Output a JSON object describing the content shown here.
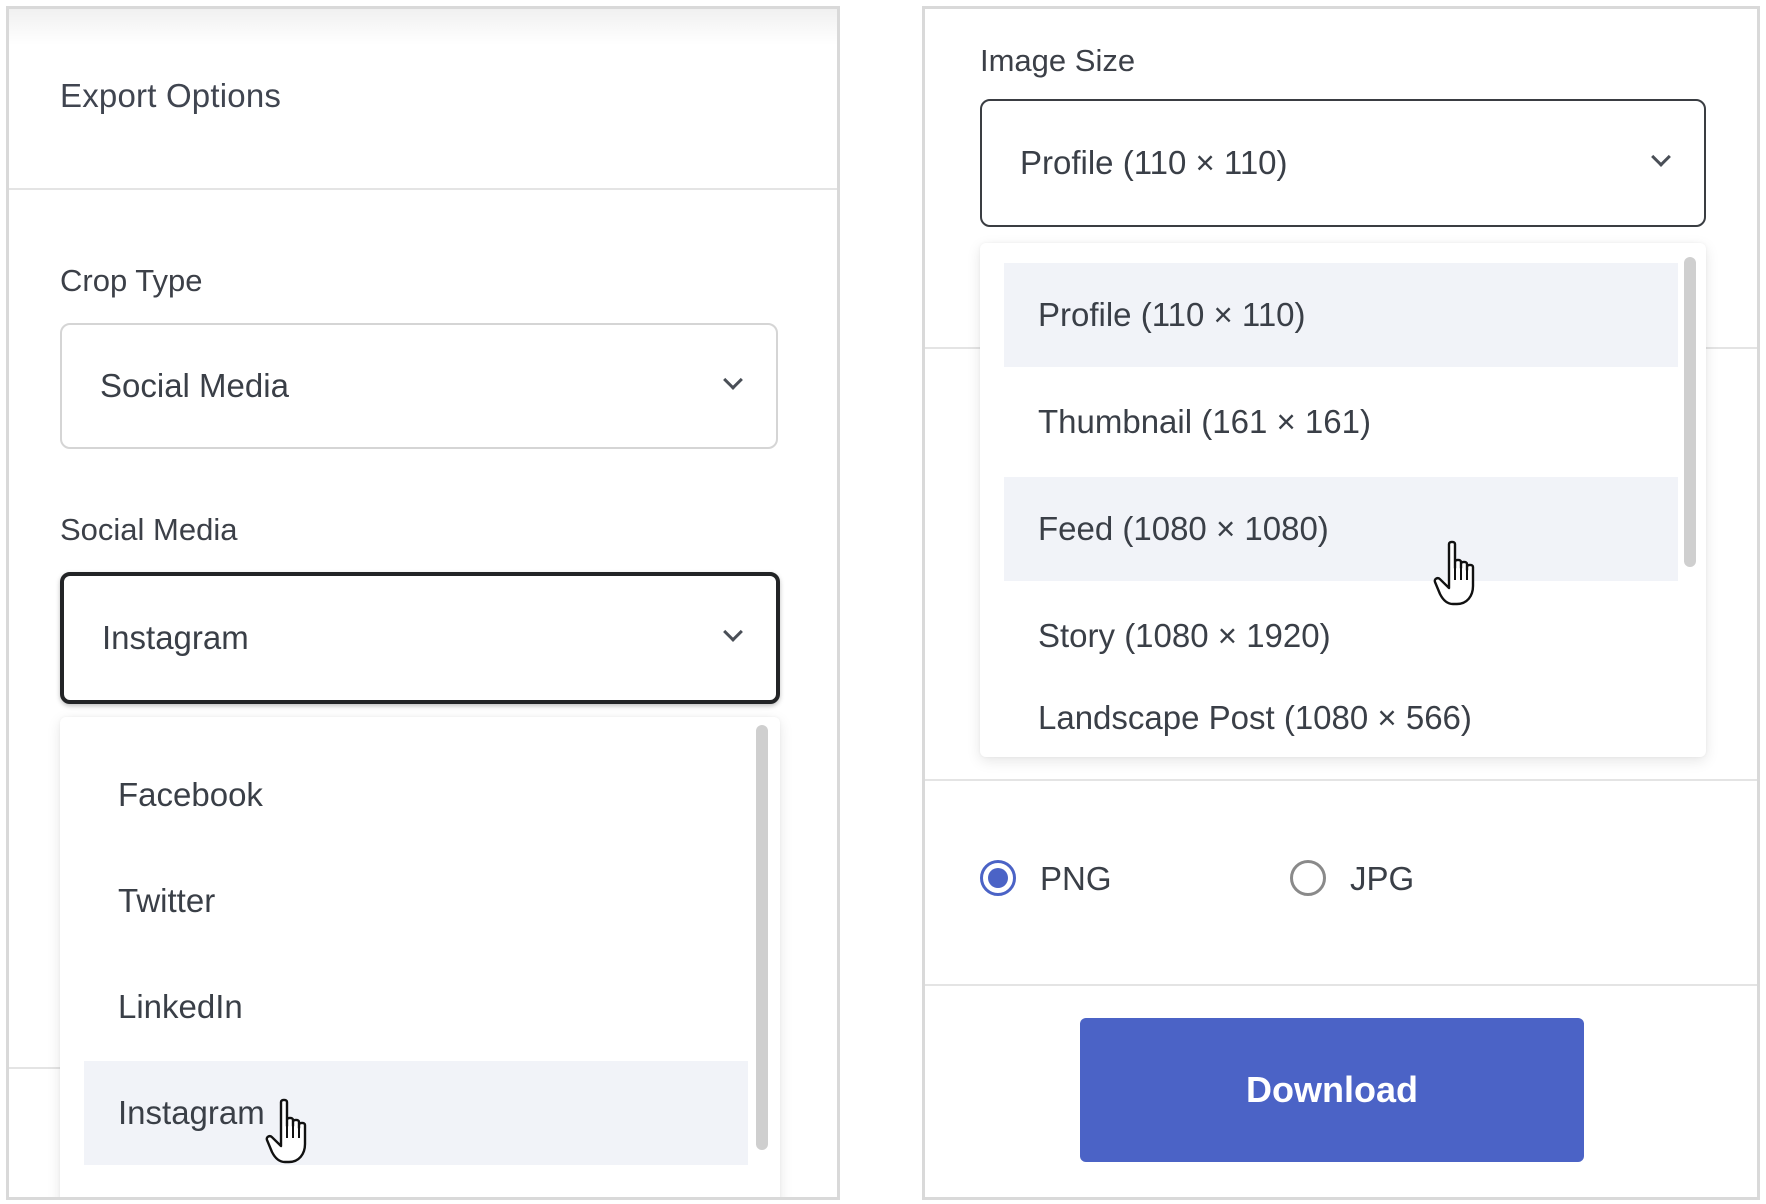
{
  "left_panel": {
    "title": "Export Options",
    "crop_type": {
      "label": "Crop Type",
      "value": "Social Media"
    },
    "social_media": {
      "label": "Social Media",
      "value": "Instagram",
      "options": [
        "Facebook",
        "Twitter",
        "LinkedIn",
        "Instagram"
      ],
      "highlighted": "Instagram"
    }
  },
  "right_panel": {
    "image_size": {
      "label": "Image Size",
      "value": "Profile (110 × 110)",
      "options": [
        "Profile (110 × 110)",
        "Thumbnail (161 × 161)",
        "Feed (1080 × 1080)",
        "Story (1080 × 1920)",
        "Landscape Post (1080 × 566)"
      ]
    },
    "format": {
      "options": [
        "PNG",
        "JPG"
      ],
      "selected": "PNG"
    },
    "download_label": "Download"
  },
  "colors": {
    "accent": "#4b63c6",
    "highlight": "#f1f3f8",
    "border": "#d9d9d9"
  },
  "icons": [
    "chevron-down-icon",
    "hand-pointer-cursor-icon",
    "radio-icon"
  ]
}
